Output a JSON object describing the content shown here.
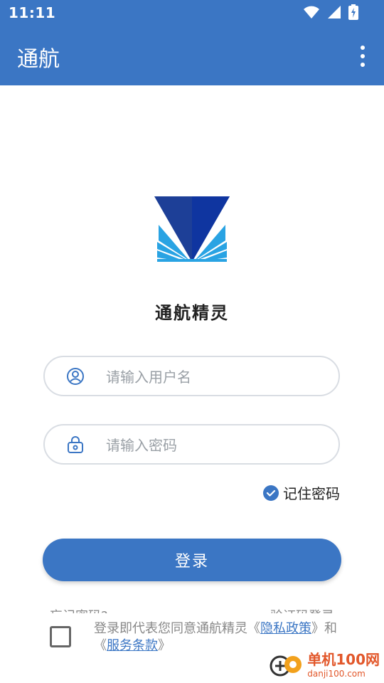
{
  "status_bar": {
    "time": "11:11"
  },
  "app_bar": {
    "title": "通航"
  },
  "app": {
    "name": "通航精灵"
  },
  "form": {
    "username_placeholder": "请输入用户名",
    "password_placeholder": "请输入密码",
    "remember_label": "记住密码",
    "remember_checked": true,
    "login_label": "登录",
    "forgot_label": "忘记密码?",
    "sms_login_label": "验证码登录"
  },
  "agreement": {
    "prefix": "登录即代表您同意通航精灵《",
    "privacy": "隐私政策",
    "middle": "》和《",
    "terms": "服务条款",
    "suffix": "》"
  },
  "watermark": {
    "name": "单机100网",
    "site": "danji100.com"
  },
  "colors": {
    "primary": "#3b76c4",
    "logo_dark": "#1d3f97",
    "logo_light": "#29a3e3"
  }
}
